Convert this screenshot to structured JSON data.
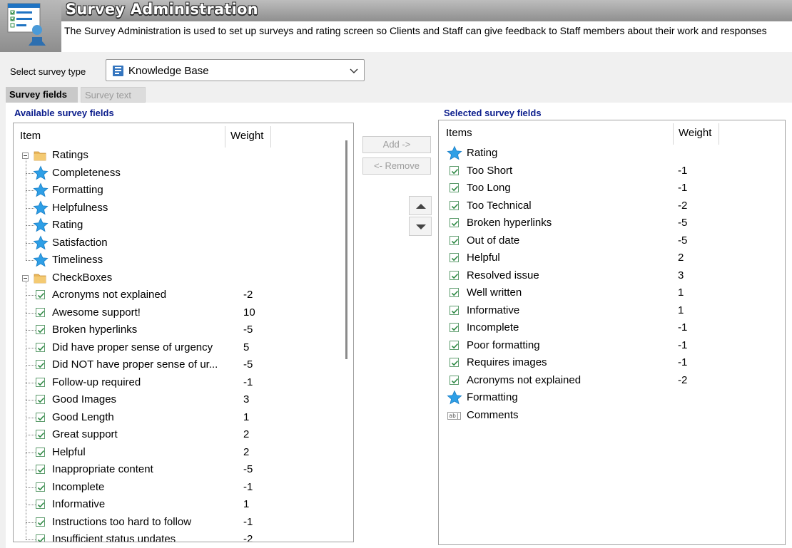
{
  "header": {
    "title": "Survey Administration",
    "description": "The Survey Administration is used to set up surveys and rating screen so Clients and Staff can give feedback to Staff members about their work and responses",
    "icon": "survey-admin-icon"
  },
  "survey_type": {
    "label": "Select survey type",
    "selected": "Knowledge Base"
  },
  "tabs": [
    {
      "label": "Survey fields",
      "active": true
    },
    {
      "label": "Survey text",
      "active": false
    }
  ],
  "available": {
    "section_label": "Available survey fields",
    "col_item": "Item",
    "col_weight": "Weight",
    "groups": [
      {
        "label": "Ratings",
        "items": [
          {
            "label": "Completeness"
          },
          {
            "label": "Formatting"
          },
          {
            "label": "Helpfulness"
          },
          {
            "label": "Rating"
          },
          {
            "label": "Satisfaction"
          },
          {
            "label": "Timeliness"
          }
        ]
      },
      {
        "label": "CheckBoxes",
        "items": [
          {
            "label": "Acronyms not explained",
            "weight": "-2"
          },
          {
            "label": "Awesome support!",
            "weight": "10"
          },
          {
            "label": "Broken hyperlinks",
            "weight": "-5"
          },
          {
            "label": "Did have proper sense of urgency",
            "weight": "5"
          },
          {
            "label": "Did NOT have proper sense of ur...",
            "weight": "-5"
          },
          {
            "label": "Follow-up required",
            "weight": "-1"
          },
          {
            "label": "Good Images",
            "weight": "3"
          },
          {
            "label": "Good Length",
            "weight": "1"
          },
          {
            "label": "Great support",
            "weight": "2"
          },
          {
            "label": "Helpful",
            "weight": "2"
          },
          {
            "label": "Inappropriate content",
            "weight": "-5"
          },
          {
            "label": "Incomplete",
            "weight": "-1"
          },
          {
            "label": "Informative",
            "weight": "1"
          },
          {
            "label": "Instructions too hard to follow",
            "weight": "-1"
          },
          {
            "label": "Insufficient status updates",
            "weight": "-2"
          }
        ]
      }
    ]
  },
  "buttons": {
    "add": "Add ->",
    "remove": "<- Remove"
  },
  "selected": {
    "section_label": "Selected survey fields",
    "col_item": "Items",
    "col_weight": "Weight",
    "items": [
      {
        "type": "rating",
        "label": "Rating",
        "weight": ""
      },
      {
        "type": "check",
        "label": "Too Short",
        "weight": "-1"
      },
      {
        "type": "check",
        "label": "Too Long",
        "weight": "-1"
      },
      {
        "type": "check",
        "label": "Too Technical",
        "weight": "-2"
      },
      {
        "type": "check",
        "label": "Broken hyperlinks",
        "weight": "-5"
      },
      {
        "type": "check",
        "label": "Out of date",
        "weight": "-5"
      },
      {
        "type": "check",
        "label": "Helpful",
        "weight": "2"
      },
      {
        "type": "check",
        "label": "Resolved issue",
        "weight": "3"
      },
      {
        "type": "check",
        "label": "Well written",
        "weight": "1"
      },
      {
        "type": "check",
        "label": "Informative",
        "weight": "1"
      },
      {
        "type": "check",
        "label": "Incomplete",
        "weight": "-1"
      },
      {
        "type": "check",
        "label": "Poor formatting",
        "weight": "-1"
      },
      {
        "type": "check",
        "label": "Requires images",
        "weight": "-1"
      },
      {
        "type": "check",
        "label": "Acronyms not explained",
        "weight": "-2"
      },
      {
        "type": "rating",
        "label": "Formatting",
        "weight": ""
      },
      {
        "type": "text",
        "label": "Comments",
        "weight": "",
        "icon_text": "ab|"
      }
    ]
  },
  "colors": {
    "section_label": "#0b1d8c",
    "star": "#2e9fe6",
    "checkbox_border": "#5d9c6d",
    "checkmark": "#2f8a45",
    "header_band": "#a6a6a6"
  }
}
